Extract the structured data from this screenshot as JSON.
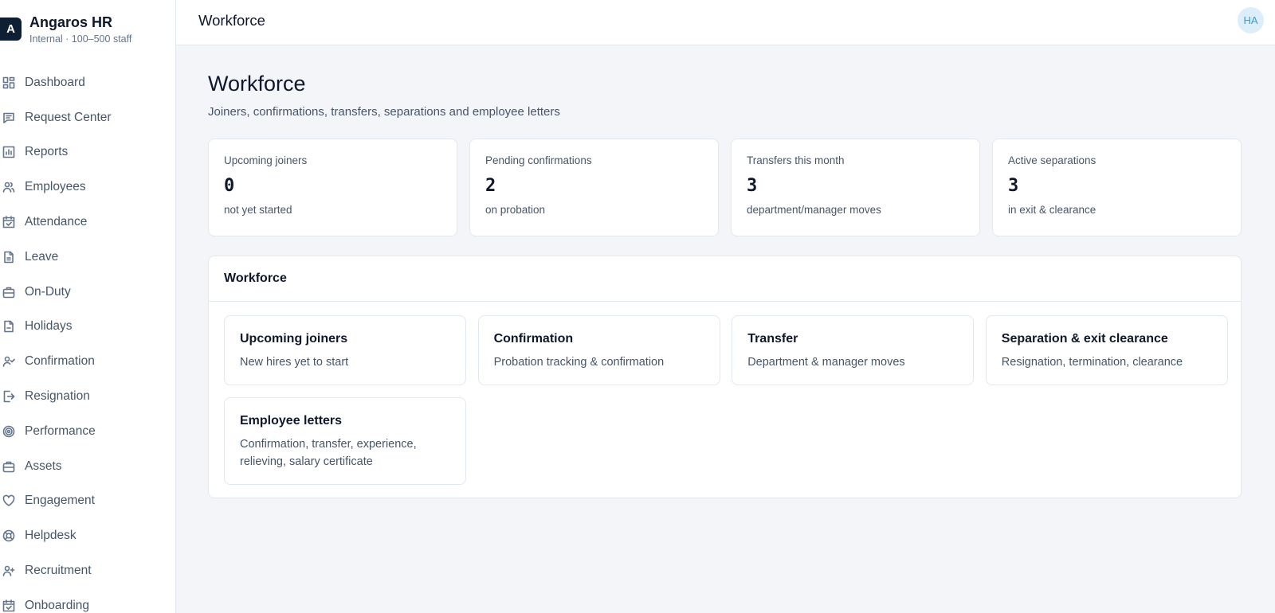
{
  "brand": {
    "logo_letter": "A",
    "name": "Angaros HR",
    "subtitle": "Internal · 100–500 staff"
  },
  "sidebar": {
    "items": [
      {
        "label": "Dashboard",
        "icon": "dashboard-icon"
      },
      {
        "label": "Request Center",
        "icon": "message-square-icon"
      },
      {
        "label": "Reports",
        "icon": "bar-chart-icon"
      },
      {
        "label": "Employees",
        "icon": "users-icon"
      },
      {
        "label": "Attendance",
        "icon": "calendar-check-icon"
      },
      {
        "label": "Leave",
        "icon": "file-text-icon"
      },
      {
        "label": "On-Duty",
        "icon": "briefcase-icon"
      },
      {
        "label": "Holidays",
        "icon": "file-icon"
      },
      {
        "label": "Confirmation",
        "icon": "user-check-icon"
      },
      {
        "label": "Resignation",
        "icon": "log-out-icon"
      },
      {
        "label": "Performance",
        "icon": "target-icon"
      },
      {
        "label": "Assets",
        "icon": "briefcase-icon"
      },
      {
        "label": "Engagement",
        "icon": "heart-icon"
      },
      {
        "label": "Helpdesk",
        "icon": "life-buoy-icon"
      },
      {
        "label": "Recruitment",
        "icon": "user-plus-icon"
      },
      {
        "label": "Onboarding",
        "icon": "calendar-check-icon"
      }
    ]
  },
  "topbar": {
    "title": "Workforce",
    "avatar_initials": "HA"
  },
  "page": {
    "title": "Workforce",
    "subtitle": "Joiners, confirmations, transfers, separations and employee letters"
  },
  "stats": [
    {
      "label": "Upcoming joiners",
      "value": "0",
      "note": "not yet started"
    },
    {
      "label": "Pending confirmations",
      "value": "2",
      "note": "on probation"
    },
    {
      "label": "Transfers this month",
      "value": "3",
      "note": "department/manager moves"
    },
    {
      "label": "Active separations",
      "value": "3",
      "note": "in exit & clearance"
    }
  ],
  "panel": {
    "title": "Workforce",
    "tiles": [
      {
        "title": "Upcoming joiners",
        "desc": "New hires yet to start"
      },
      {
        "title": "Confirmation",
        "desc": "Probation tracking & confirmation"
      },
      {
        "title": "Transfer",
        "desc": "Department & manager moves"
      },
      {
        "title": "Separation & exit clearance",
        "desc": "Resignation, termination, clearance"
      },
      {
        "title": "Employee letters",
        "desc": "Confirmation, transfer, experience, relieving, salary certificate"
      }
    ]
  },
  "colors": {
    "brand_dark": "#0f1f33",
    "avatar_bg": "#dbeefa",
    "avatar_text": "#3b9bd6",
    "page_bg": "#f3f5f8"
  }
}
